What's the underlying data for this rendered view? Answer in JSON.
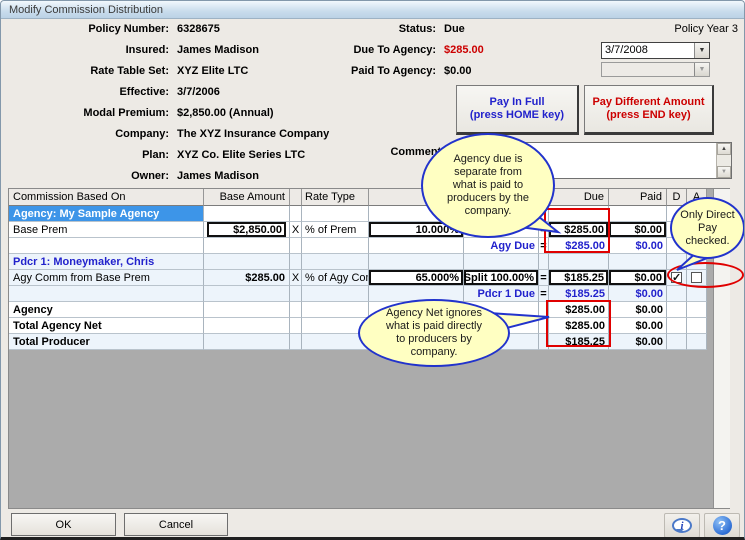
{
  "dialog": {
    "title": "Modify Commission Distribution"
  },
  "form": {
    "left": [
      {
        "label": "Policy Number:",
        "value": "6328675"
      },
      {
        "label": "Insured:",
        "value": "James Madison"
      },
      {
        "label": "Rate Table Set:",
        "value": "XYZ Elite LTC"
      },
      {
        "label": "Effective:",
        "value": "3/7/2006"
      },
      {
        "label": "Modal Premium:",
        "value": "$2,850.00 (Annual)"
      },
      {
        "label": "Company:",
        "value": "The XYZ Insurance Company"
      },
      {
        "label": "Plan:",
        "value": "XYZ Co. Elite Series LTC"
      },
      {
        "label": "Owner:",
        "value": "James Madison"
      }
    ],
    "right": [
      {
        "label": "Status:",
        "value": "Due"
      },
      {
        "label": "Due To Agency:",
        "value": "$285.00"
      },
      {
        "label": "Paid To Agency:",
        "value": "$0.00"
      }
    ],
    "policy_year": "Policy Year 3",
    "date_value": "3/7/2008",
    "comments_label": "Comments:"
  },
  "pay_buttons": {
    "pay_full_line1": "Pay In Full",
    "pay_full_line2": "(press HOME key)",
    "pay_diff_line1": "Pay Different Amount",
    "pay_diff_line2": "(press END key)"
  },
  "table": {
    "headers": {
      "name": "Commission Based On",
      "base": "Base Amount",
      "rate_type": "Rate Type",
      "due": "Due",
      "paid": "Paid",
      "d": "D",
      "a": "A"
    },
    "rows": [
      {
        "name": "Agency: My Sample Agency"
      },
      {
        "name": "Base Prem",
        "base": "$2,850.00",
        "x": "X",
        "rate_type": "% of Prem",
        "rate": "10.000%",
        "eq": "=",
        "due": "$285.00",
        "paid": "$0.00"
      },
      {
        "split": "Agy Due",
        "eq": "=",
        "due": "$285.00",
        "paid": "$0.00"
      },
      {
        "name": "Pdcr 1: Moneymaker, Chris"
      },
      {
        "name": "Agy Comm from Base Prem",
        "base": "$285.00",
        "x": "X",
        "rate_type": "% of Agy Comm",
        "rate": "65.000%",
        "split": "Split 100.00%",
        "eq": "=",
        "due": "$185.25",
        "paid": "$0.00",
        "direct_pay_checked": true,
        "advance_checked": false
      },
      {
        "split": "Pdcr 1 Due",
        "eq": "=",
        "due": "$185.25",
        "paid": "$0.00"
      },
      {
        "name": "Agency",
        "due": "$285.00",
        "paid": "$0.00"
      },
      {
        "name": "Total Agency Net",
        "due": "$285.00",
        "paid": "$0.00"
      },
      {
        "name": "Total Producer",
        "due": "$185.25",
        "paid": "$0.00"
      }
    ]
  },
  "callouts": {
    "agency_due": {
      "lines": [
        "Agency due is",
        "separate from",
        "what is paid to",
        "producers by the",
        "company."
      ]
    },
    "direct_pay": {
      "lines": [
        "Only Direct",
        "Pay",
        "checked."
      ]
    },
    "agency_net": {
      "lines": [
        "Agency Net ignores",
        "what is paid directly",
        "to producers by",
        "company."
      ]
    }
  },
  "footer": {
    "ok": "OK",
    "cancel": "Cancel"
  },
  "icons": {
    "info": "i",
    "help": "?",
    "dropdown_arrow": "▼",
    "scroll_up": "▲",
    "scroll_down": "▼"
  },
  "colors": {
    "due_red": "#CC0000",
    "link_blue": "#2222CC",
    "selected_row": "#3D95E8",
    "annotation_red": "#E00000",
    "callout_yellow": "#FFFFC2",
    "callout_border": "#2233CC"
  }
}
